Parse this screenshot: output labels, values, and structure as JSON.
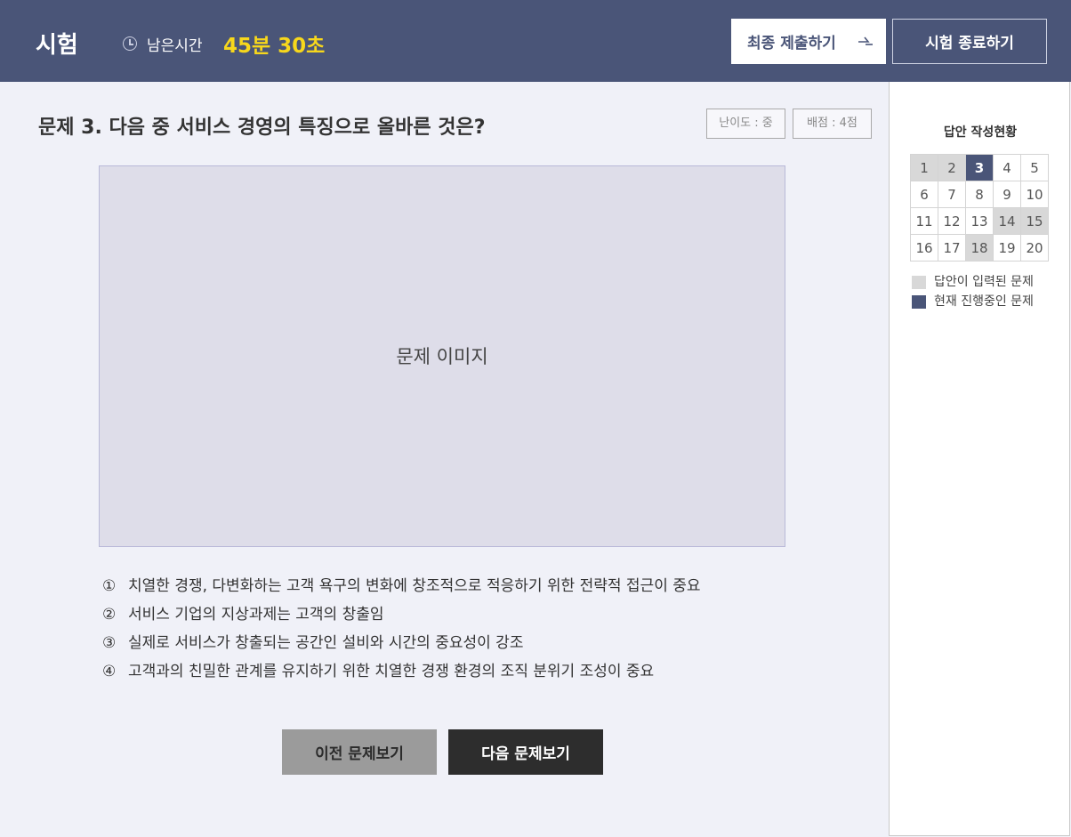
{
  "header": {
    "title": "시험",
    "timer_label": "남은시간",
    "timer_value": "45분 30초",
    "submit_label": "최종 제출하기",
    "end_label": "시험 종료하기"
  },
  "question": {
    "title": "문제 3. 다음 중 서비스 경영의 특징으로 올바른 것은?",
    "difficulty": "난이도 : 중",
    "score": "배점 : 4점",
    "image_label": "문제 이미지",
    "choices": [
      {
        "num": "①",
        "text": "치열한 경쟁, 다변화하는 고객 욕구의 변화에 창조적으로 적응하기 위한 전략적 접근이 중요"
      },
      {
        "num": "②",
        "text": "서비스 기업의 지상과제는 고객의 창출임"
      },
      {
        "num": "③",
        "text": "실제로 서비스가 창출되는 공간인 설비와 시간의 중요성이 강조"
      },
      {
        "num": "④",
        "text": "고객과의 친밀한 관계를 유지하기 위한 치열한 경쟁 환경의 조직 분위기 조성이 중요"
      }
    ]
  },
  "navigation": {
    "prev_label": "이전 문제보기",
    "next_label": "다음 문제보기"
  },
  "sidebar": {
    "title": "답안 작성현황",
    "grid": [
      [
        "1",
        "2",
        "3",
        "4",
        "5"
      ],
      [
        "6",
        "7",
        "8",
        "9",
        "10"
      ],
      [
        "11",
        "12",
        "13",
        "14",
        "15"
      ],
      [
        "16",
        "17",
        "18",
        "19",
        "20"
      ]
    ],
    "answered": [
      1,
      2,
      14,
      15,
      18
    ],
    "current": 3,
    "legend_answered": "답안이 입력된 문제",
    "legend_current": "현재 진행중인 문제"
  },
  "colors": {
    "header_bg": "#4a5578",
    "timer": "#f7d71c",
    "answered": "#d8d8d8",
    "current": "#4a5578"
  }
}
